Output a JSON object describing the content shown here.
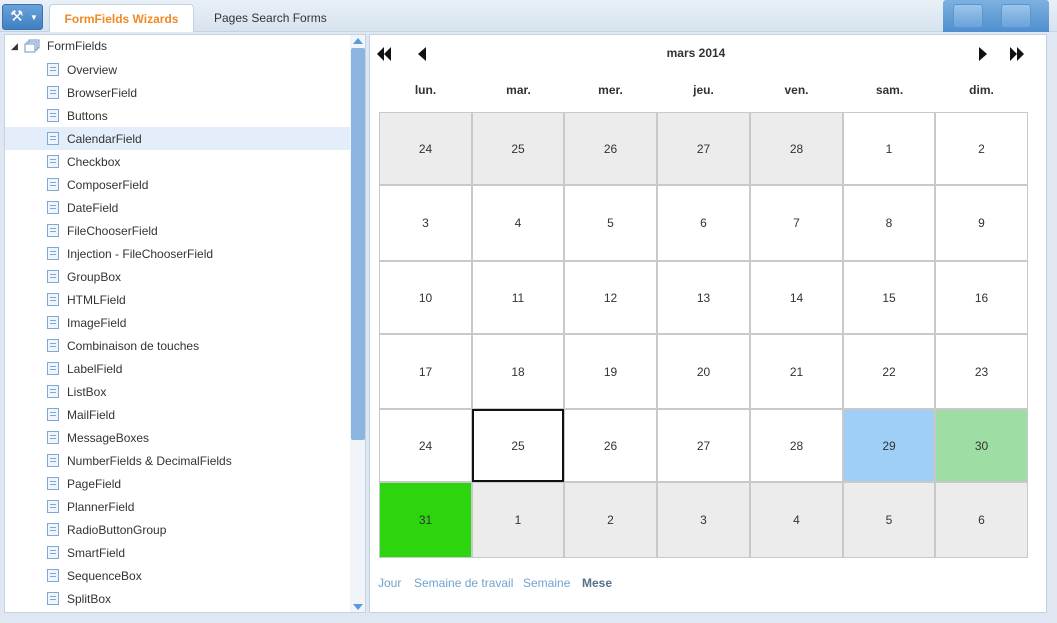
{
  "tabs": [
    {
      "label": "FormFields Wizards",
      "active": true
    },
    {
      "label": "Pages Search Forms",
      "active": false
    }
  ],
  "tree": {
    "root": "FormFields",
    "items": [
      "Overview",
      "BrowserField",
      "Buttons",
      "CalendarField",
      "Checkbox",
      "ComposerField",
      "DateField",
      "FileChooserField",
      "Injection - FileChooserField",
      "GroupBox",
      "HTMLField",
      "ImageField",
      "Combinaison de touches",
      "LabelField",
      "ListBox",
      "MailField",
      "MessageBoxes",
      "NumberFields & DecimalFields",
      "PageField",
      "PlannerField",
      "RadioButtonGroup",
      "SmartField",
      "SequenceBox",
      "SplitBox"
    ],
    "selected": "CalendarField"
  },
  "calendar": {
    "title": "mars 2014",
    "weekdays": [
      "lun.",
      "mar.",
      "mer.",
      "jeu.",
      "ven.",
      "sam.",
      "dim."
    ],
    "weeks": [
      [
        "24",
        "25",
        "26",
        "27",
        "28",
        "1",
        "2"
      ],
      [
        "3",
        "4",
        "5",
        "6",
        "7",
        "8",
        "9"
      ],
      [
        "10",
        "11",
        "12",
        "13",
        "14",
        "15",
        "16"
      ],
      [
        "17",
        "18",
        "19",
        "20",
        "21",
        "22",
        "23"
      ],
      [
        "24",
        "25",
        "26",
        "27",
        "28",
        "29",
        "30"
      ],
      [
        "31",
        "1",
        "2",
        "3",
        "4",
        "5",
        "6"
      ]
    ],
    "views": [
      "Jour",
      "Semaine de travail",
      "Semaine",
      "Mese"
    ],
    "active_view": "Mese"
  },
  "colors": {
    "accent_tab": "#f08a24",
    "today_border": "#111111",
    "saturday_highlight": "#9fcff7",
    "sunday_highlight": "#9edea5",
    "selected_day": "#2cd50d"
  },
  "icons": [
    "tools-icon",
    "chevron-down-icon",
    "folder-tree-icon",
    "document-icon",
    "double-left-arrow-icon",
    "left-arrow-icon",
    "right-arrow-icon",
    "double-right-arrow-icon"
  ]
}
